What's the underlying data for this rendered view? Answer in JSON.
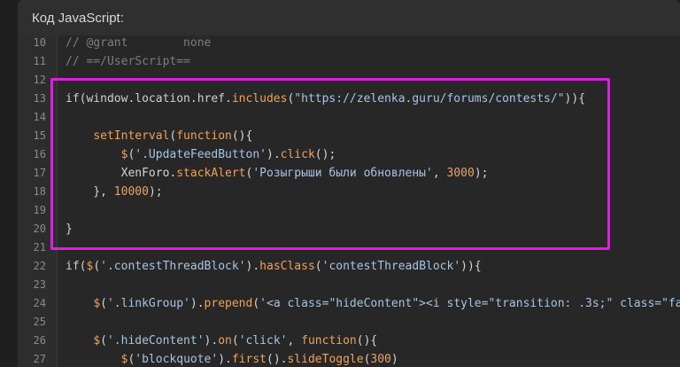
{
  "header": {
    "title": "Код JavaScript:"
  },
  "code": {
    "lines": [
      {
        "n": "10",
        "tokens": [
          [
            "c",
            "// @grant        none"
          ]
        ]
      },
      {
        "n": "11",
        "tokens": [
          [
            "c",
            "// ==/UserScript=="
          ]
        ]
      },
      {
        "n": "12",
        "tokens": []
      },
      {
        "n": "13",
        "tokens": [
          [
            "k",
            "if(window.location.href."
          ],
          [
            "f",
            "includes"
          ],
          [
            "p",
            "("
          ],
          [
            "s",
            "\"https://zelenka.guru/forums/contests/\""
          ],
          [
            "p",
            ")){"
          ]
        ]
      },
      {
        "n": "14",
        "tokens": []
      },
      {
        "n": "15",
        "tokens": [
          [
            "p",
            "    "
          ],
          [
            "f",
            "setInterval"
          ],
          [
            "p",
            "("
          ],
          [
            "f",
            "function"
          ],
          [
            "p",
            "(){"
          ]
        ]
      },
      {
        "n": "16",
        "tokens": [
          [
            "p",
            "        "
          ],
          [
            "f",
            "$"
          ],
          [
            "p",
            "("
          ],
          [
            "s",
            "'.UpdateFeedButton'"
          ],
          [
            "p",
            ")."
          ],
          [
            "f",
            "click"
          ],
          [
            "p",
            "();"
          ]
        ]
      },
      {
        "n": "17",
        "tokens": [
          [
            "p",
            "        XenForo."
          ],
          [
            "f",
            "stackAlert"
          ],
          [
            "p",
            "("
          ],
          [
            "s",
            "'Розыгрыши были обновлены'"
          ],
          [
            "p",
            ", "
          ],
          [
            "n",
            "3000"
          ],
          [
            "p",
            ");"
          ]
        ]
      },
      {
        "n": "18",
        "tokens": [
          [
            "p",
            "    }, "
          ],
          [
            "n",
            "10000"
          ],
          [
            "p",
            ");"
          ]
        ]
      },
      {
        "n": "19",
        "tokens": []
      },
      {
        "n": "20",
        "tokens": [
          [
            "p",
            "}"
          ]
        ]
      },
      {
        "n": "21",
        "tokens": []
      },
      {
        "n": "22",
        "tokens": [
          [
            "k",
            "if("
          ],
          [
            "f",
            "$"
          ],
          [
            "p",
            "("
          ],
          [
            "s",
            "'.contestThreadBlock'"
          ],
          [
            "p",
            ")."
          ],
          [
            "f",
            "hasClass"
          ],
          [
            "p",
            "("
          ],
          [
            "s",
            "'contestThreadBlock'"
          ],
          [
            "p",
            ")){"
          ]
        ]
      },
      {
        "n": "23",
        "tokens": []
      },
      {
        "n": "24",
        "tokens": [
          [
            "p",
            "    "
          ],
          [
            "f",
            "$"
          ],
          [
            "p",
            "("
          ],
          [
            "s",
            "'.linkGroup'"
          ],
          [
            "p",
            ")."
          ],
          [
            "f",
            "prepend"
          ],
          [
            "p",
            "("
          ],
          [
            "s",
            "'<a class=\"hideContent\"><i style=\"transition: .3s;\" class=\"fa"
          ]
        ]
      },
      {
        "n": "25",
        "tokens": []
      },
      {
        "n": "26",
        "tokens": [
          [
            "p",
            "    "
          ],
          [
            "f",
            "$"
          ],
          [
            "p",
            "("
          ],
          [
            "s",
            "'.hideContent'"
          ],
          [
            "p",
            ")."
          ],
          [
            "f",
            "on"
          ],
          [
            "p",
            "("
          ],
          [
            "s",
            "'click'"
          ],
          [
            "p",
            ", "
          ],
          [
            "f",
            "function"
          ],
          [
            "p",
            "(){"
          ]
        ]
      },
      {
        "n": "27",
        "tokens": [
          [
            "p",
            "        "
          ],
          [
            "f",
            "$"
          ],
          [
            "p",
            "("
          ],
          [
            "s",
            "'blockquote'"
          ],
          [
            "p",
            ")."
          ],
          [
            "f",
            "first"
          ],
          [
            "p",
            "()."
          ],
          [
            "f",
            "slideToggle"
          ],
          [
            "p",
            "("
          ],
          [
            "n",
            "300"
          ],
          [
            "p",
            ")"
          ]
        ]
      }
    ]
  }
}
